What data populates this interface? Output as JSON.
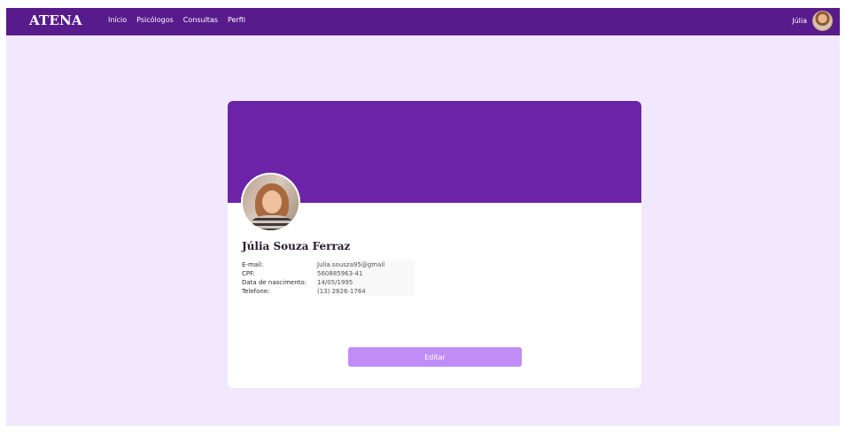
{
  "navbar": {
    "brand": "ATENA",
    "links": [
      {
        "label": "Início"
      },
      {
        "label": "Psicólogos"
      },
      {
        "label": "Consultas"
      },
      {
        "label": "Perfil"
      }
    ],
    "user_name": "Júlia"
  },
  "profile": {
    "name": "Júlia Souza Ferraz",
    "fields": [
      {
        "label": "E-mail:",
        "value": "Julia.sousza95@gmail"
      },
      {
        "label": "CPF:",
        "value": "560885963-41"
      },
      {
        "label": "Data de nascimento:",
        "value": "14/05/1995"
      },
      {
        "label": "Telefone:",
        "value": "(13) 2826-1764"
      }
    ],
    "edit_label": "Editar"
  },
  "colors": {
    "navbar": "#581b8c",
    "banner": "#6d23a8",
    "background": "#f1e8fd",
    "button": "#c08cf6"
  }
}
